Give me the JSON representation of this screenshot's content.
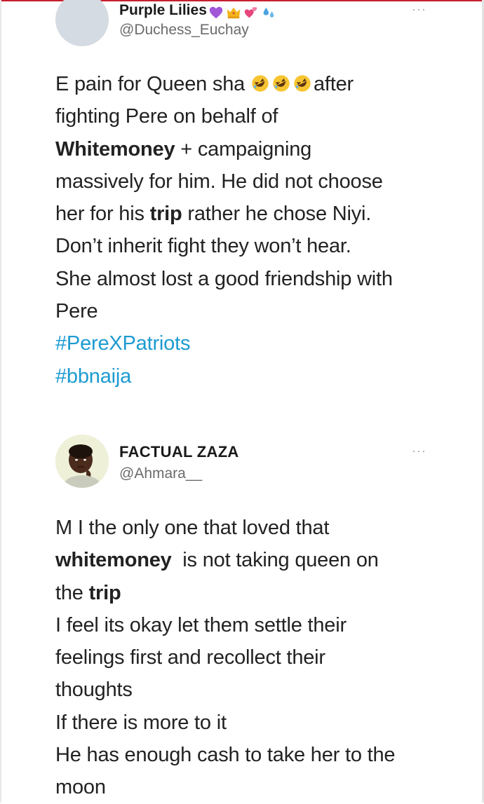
{
  "tweets": [
    {
      "display_name": "Purple Lilies",
      "name_emojis": [
        "purple-heart-icon",
        "crown-icon",
        "two-hearts-icon",
        "sweat-droplets-icon"
      ],
      "handle": "@Duchess_Euchay",
      "more": "···",
      "avatar": "avatar-placeholder",
      "body": {
        "l1_a": "E pain for Queen sha",
        "l1_emojis": [
          "rolling-laugh-icon",
          "rolling-laugh-icon",
          "rolling-laugh-icon"
        ],
        "l1_b": "after",
        "l2": "fighting Pere on behalf of",
        "l3_bold": "Whitemoney",
        "l3_rest": " + campaigning",
        "l4": "massively for him. He did not choose",
        "l5_a": "her for his ",
        "l5_bold": "trip",
        "l5_b": " rather he chose Niyi.",
        "l6": "Don’t inherit fight they won’t hear.",
        "l7": "She almost lost a good friendship with",
        "l8": "Pere",
        "hashtag1": "#PereXPatriots",
        "hashtag2": "#bbnaija"
      }
    },
    {
      "display_name": "FACTUAL ZAZA",
      "handle": "@Ahmara__",
      "more": "···",
      "avatar": "avatar-photo",
      "body": {
        "l1": "M I the only one that loved that",
        "l2_bold": "whitemoney",
        "l2_rest": "  is not taking queen on",
        "l3_a": "the ",
        "l3_bold": "trip",
        "l4": "I feel its okay let them settle their",
        "l5": "feelings first and recollect their",
        "l6": "thoughts",
        "l7": "If there is more to it",
        "l8": "He has enough cash to take her to the",
        "l9": "moon"
      }
    }
  ],
  "colors": {
    "hashtag": "#1d9bd1",
    "top_accent": "#c91f2e",
    "handle": "#6b6b6b"
  }
}
